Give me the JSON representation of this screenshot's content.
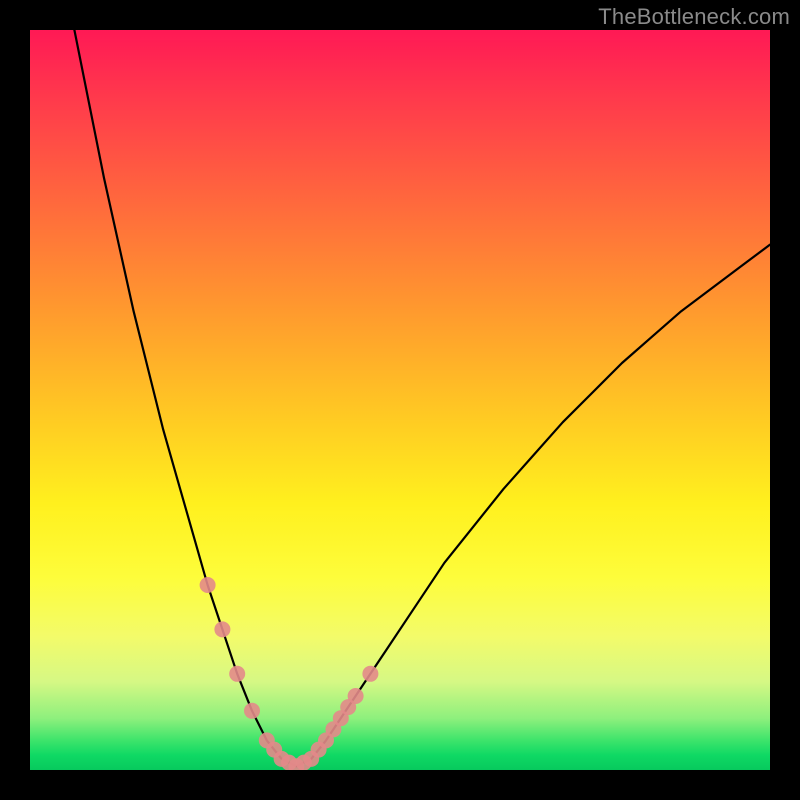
{
  "watermark": "TheBottleneck.com",
  "chart_data": {
    "type": "line",
    "title": "",
    "xlabel": "",
    "ylabel": "",
    "xlim": [
      0,
      100
    ],
    "ylim": [
      0,
      100
    ],
    "grid": false,
    "legend": false,
    "series": [
      {
        "name": "curve",
        "x": [
          6,
          8,
          10,
          12,
          14,
          16,
          18,
          20,
          22,
          24,
          26,
          28,
          30,
          32,
          34,
          36,
          38,
          40,
          44,
          48,
          52,
          56,
          60,
          64,
          68,
          72,
          76,
          80,
          84,
          88,
          92,
          96,
          100
        ],
        "y": [
          100,
          90,
          80,
          71,
          62,
          54,
          46,
          39,
          32,
          25,
          19,
          13,
          8,
          4,
          1.5,
          0.5,
          1.5,
          4,
          10,
          16,
          22,
          28,
          33,
          38,
          42.5,
          47,
          51,
          55,
          58.5,
          62,
          65,
          68,
          71
        ],
        "note": "V-shaped bottleneck curve; minimum near x≈35. Values estimated from chart pixels on a 0–100 scale per axis."
      }
    ],
    "markers": {
      "note": "Pink rounded markers drawn along the lower portion of both branches of the curve.",
      "points_on_curve_x": [
        24,
        26,
        28,
        30,
        32,
        33,
        34,
        35,
        36,
        37,
        38,
        39,
        40,
        41,
        42,
        43,
        44,
        46
      ],
      "color": "#e38a8a",
      "size": 16
    },
    "background_gradient": {
      "top": "#ff1955",
      "mid": "#ffe423",
      "bottom": "#07c95d"
    }
  }
}
